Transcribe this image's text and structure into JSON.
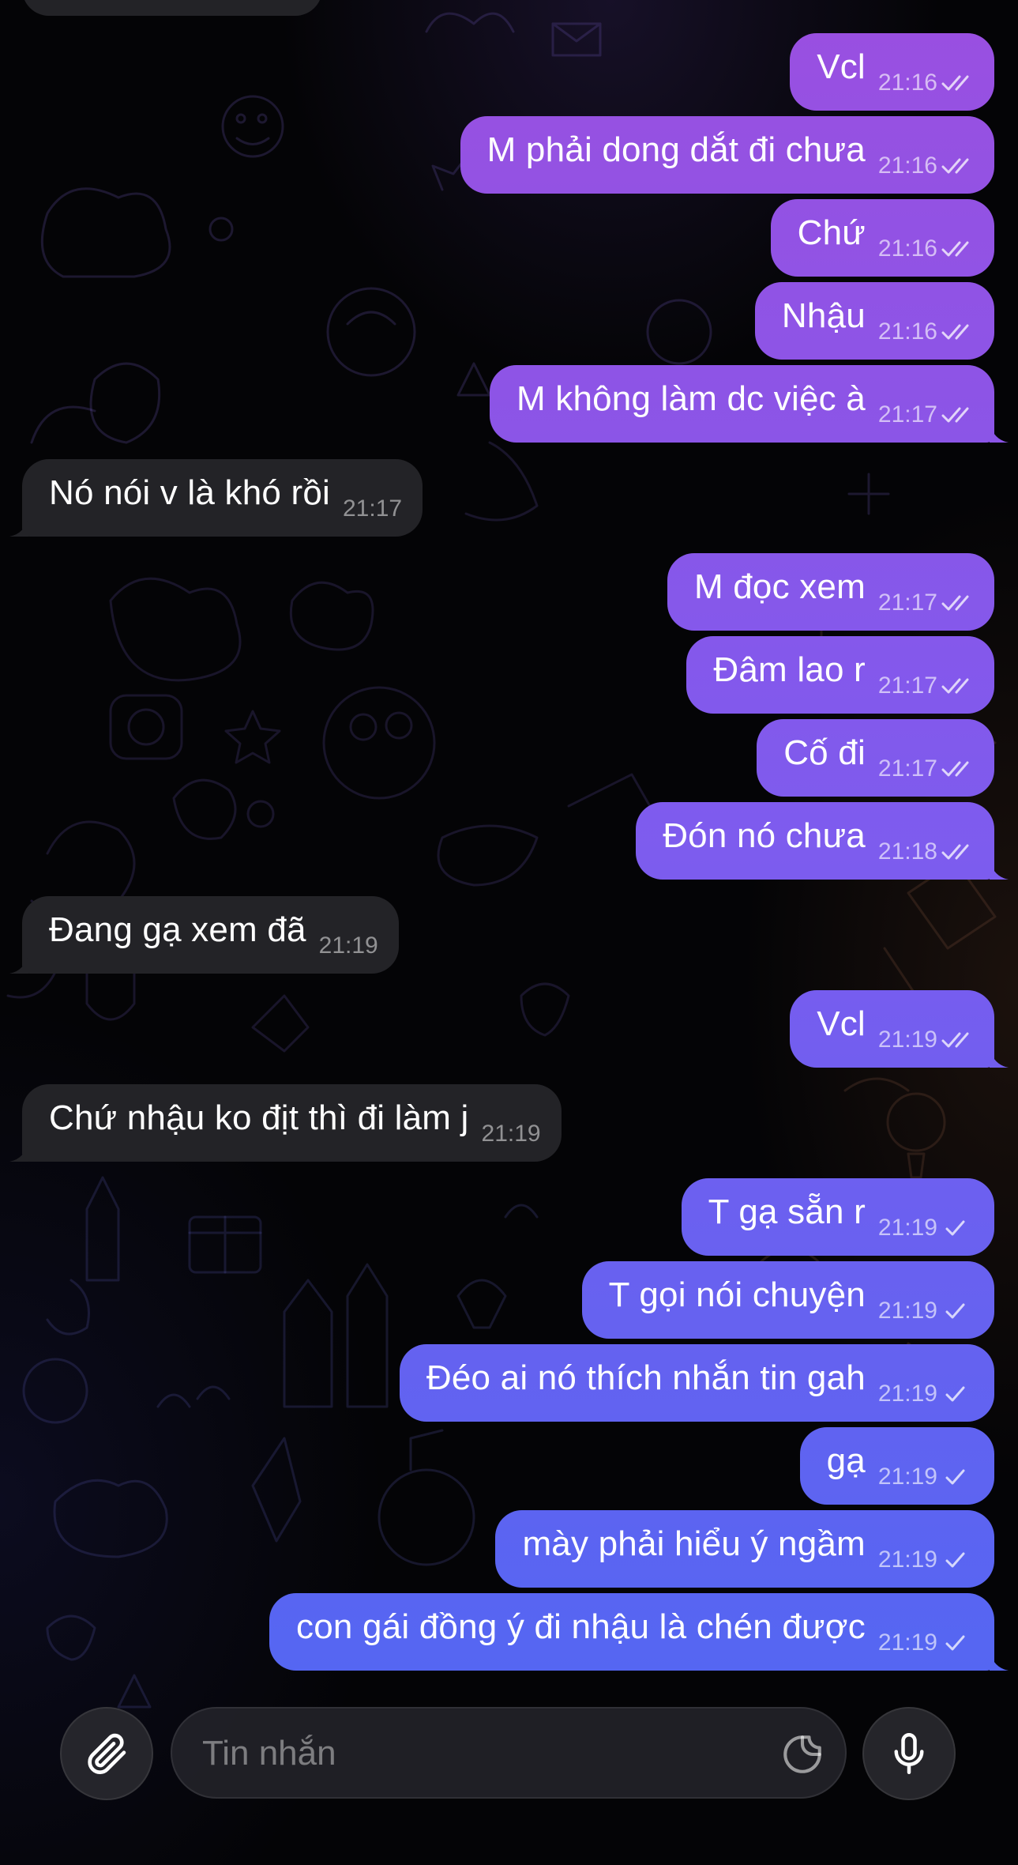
{
  "chat": {
    "messages": [
      {
        "side": "out",
        "text": "Vcl",
        "time": "21:16",
        "status": "read"
      },
      {
        "side": "out",
        "text": "M phải dong dắt đi chưa",
        "time": "21:16",
        "status": "read"
      },
      {
        "side": "out",
        "text": "Chứ",
        "time": "21:16",
        "status": "read"
      },
      {
        "side": "out",
        "text": "Nhậu",
        "time": "21:16",
        "status": "read"
      },
      {
        "side": "out",
        "text": "M không làm dc việc à",
        "time": "21:17",
        "status": "read",
        "tail": true
      },
      {
        "side": "in",
        "text": "Nó nói v là khó rồi",
        "time": "21:17",
        "tail": true
      },
      {
        "side": "out",
        "text": "M đọc xem",
        "time": "21:17",
        "status": "read"
      },
      {
        "side": "out",
        "text": "Đâm lao r",
        "time": "21:17",
        "status": "read"
      },
      {
        "side": "out",
        "text": "Cố đi",
        "time": "21:17",
        "status": "read"
      },
      {
        "side": "out",
        "text": "Đón nó chưa",
        "time": "21:18",
        "status": "read",
        "tail": true
      },
      {
        "side": "in",
        "text": "Đang gạ xem đã",
        "time": "21:19",
        "tail": true
      },
      {
        "side": "out",
        "text": "Vcl",
        "time": "21:19",
        "status": "read",
        "tail": true
      },
      {
        "side": "in",
        "text": "Chứ nhậu ko địt thì đi làm j",
        "time": "21:19",
        "tail": true
      },
      {
        "side": "out",
        "text": "T gạ sẵn r",
        "time": "21:19",
        "status": "sent"
      },
      {
        "side": "out",
        "text": "T gọi nói chuyện",
        "time": "21:19",
        "status": "sent"
      },
      {
        "side": "out",
        "text": "Đéo ai nó thích nhắn tin gah",
        "time": "21:19",
        "status": "sent"
      },
      {
        "side": "out",
        "text": "gạ",
        "time": "21:19",
        "status": "sent"
      },
      {
        "side": "out",
        "text": "mày phải hiểu ý ngầm",
        "time": "21:19",
        "status": "sent"
      },
      {
        "side": "out",
        "text": "con gái đồng ý đi nhậu là chén được",
        "time": "21:19",
        "status": "sent",
        "tail": true
      }
    ]
  },
  "composer": {
    "placeholder": "Tin nhắn",
    "attach_icon": "paperclip-icon",
    "sticker_icon": "sticker-icon",
    "mic_icon": "microphone-icon"
  },
  "colors": {
    "outgoing_top": "#9A4FE0",
    "outgoing_mid": "#7E5BEE",
    "outgoing_bottom": "#5566F2",
    "incoming": "#232327",
    "background": "#040406"
  }
}
